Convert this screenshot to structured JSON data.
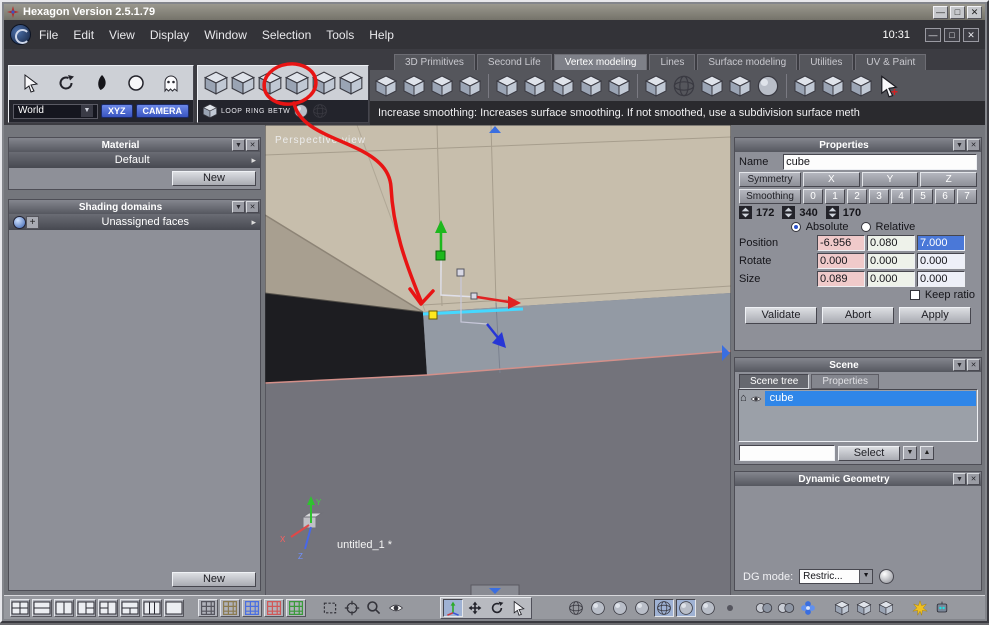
{
  "window": {
    "title": "Hexagon Version 2.5.1.79",
    "time": "10:31"
  },
  "menu": {
    "items": [
      "File",
      "Edit",
      "View",
      "Display",
      "Window",
      "Selection",
      "Tools",
      "Help"
    ]
  },
  "tabs": {
    "items": [
      "3D Primitives",
      "Second Life",
      "Vertex modeling",
      "Lines",
      "Surface modeling",
      "Utilities",
      "UV & Paint"
    ],
    "active": "Vertex modeling"
  },
  "toolbar": {
    "status_text": "Increase smoothing: Increases surface smoothing. If not smoothed, use a subdivision surface meth",
    "world": "World",
    "xyz": "XYZ",
    "camera": "CAMERA",
    "loop": "LOOP",
    "ring": "RING",
    "betw": "BETW"
  },
  "material_panel": {
    "title": "Material",
    "item": "Default",
    "new_button": "New"
  },
  "shading_panel": {
    "title": "Shading domains",
    "item": "Unassigned faces",
    "new_button": "New"
  },
  "viewport": {
    "label": "Perspective view",
    "document": "untitled_1 *",
    "axis": {
      "x": "X",
      "y": "Y",
      "z": "Z"
    }
  },
  "properties": {
    "title": "Properties",
    "name_label": "Name",
    "name_value": "cube",
    "symmetry": "Symmetry",
    "axes": [
      "X",
      "Y",
      "Z"
    ],
    "smoothing_label": "Smoothing",
    "levels": [
      "0",
      "1",
      "2",
      "3",
      "4",
      "5",
      "6",
      "7"
    ],
    "counts": [
      "172",
      "340",
      "170"
    ],
    "absolute": "Absolute",
    "relative": "Relative",
    "rows": {
      "position_label": "Position",
      "position": [
        "-6.956",
        "0.080",
        "7.000"
      ],
      "rotate_label": "Rotate",
      "rotate": [
        "0.000",
        "0.000",
        "0.000"
      ],
      "size_label": "Size",
      "size": [
        "0.089",
        "0.000",
        "0.000"
      ]
    },
    "keep_ratio": "Keep ratio",
    "validate": "Validate",
    "abort": "Abort",
    "apply": "Apply"
  },
  "scene_panel": {
    "title": "Scene",
    "tabs": [
      "Scene tree",
      "Properties"
    ],
    "item": "cube",
    "select_button": "Select"
  },
  "dg_panel": {
    "title": "Dynamic Geometry",
    "mode_label": "DG mode:",
    "mode_value": "Restric..."
  },
  "icons": {
    "triangle_down": "▼",
    "triangle_up": "▲",
    "arrow_right": "▸",
    "close": "✕",
    "house": "⌂",
    "minimize": "—",
    "maximize": "□",
    "plus": "+"
  },
  "colors": {
    "accent_blue": "#2f86e8",
    "selection_cyan": "#3fd6ff",
    "annotation_red": "#e81414",
    "field_x_tint": "#f0caca",
    "field_selected": "#4a78d8"
  }
}
